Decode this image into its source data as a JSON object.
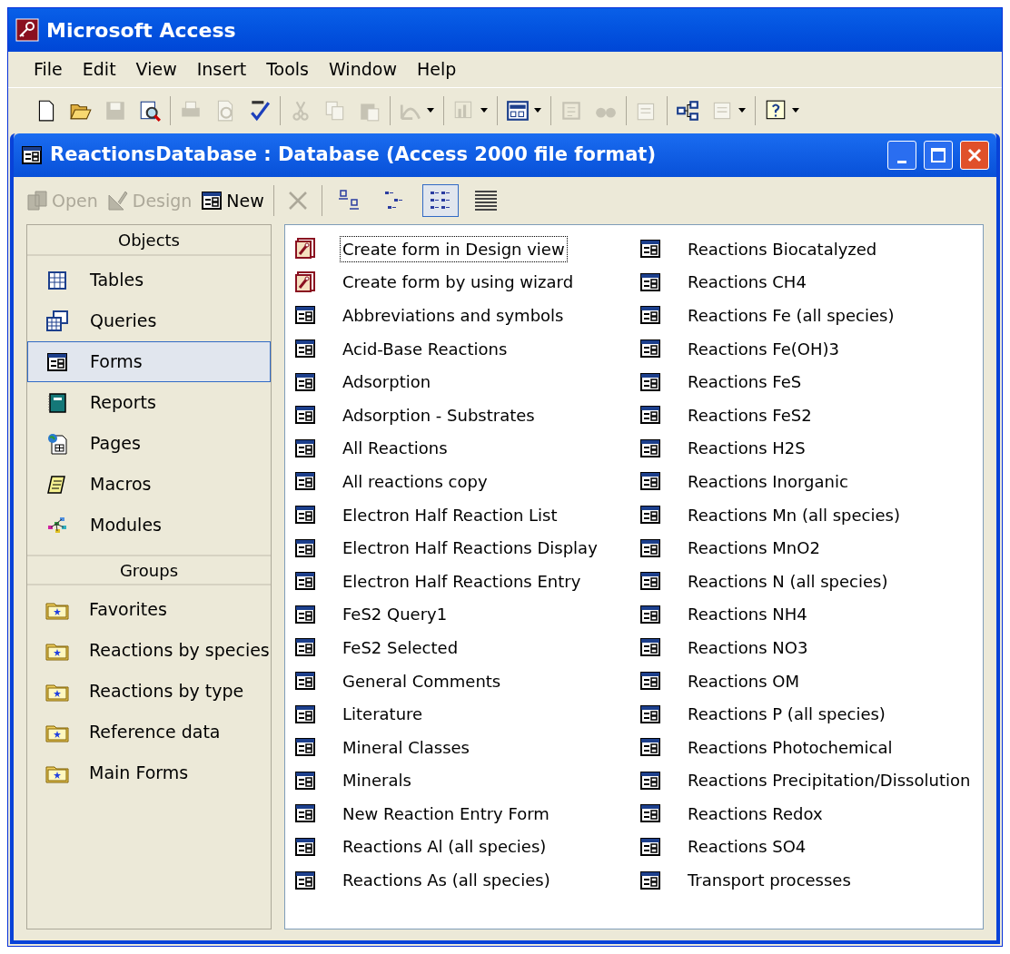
{
  "app_title": "Microsoft Access",
  "menu": [
    "File",
    "Edit",
    "View",
    "Insert",
    "Tools",
    "Window",
    "Help"
  ],
  "toolbar": [
    [
      {
        "disabled": false,
        "dropdown": false
      },
      {
        "disabled": false,
        "dropdown": false
      },
      {
        "disabled": true,
        "dropdown": false
      },
      {
        "disabled": false,
        "dropdown": false
      }
    ],
    [
      {
        "disabled": true,
        "dropdown": false
      },
      {
        "disabled": true,
        "dropdown": false
      },
      {
        "disabled": false,
        "dropdown": false
      }
    ],
    [
      {
        "disabled": true,
        "dropdown": false
      },
      {
        "disabled": true,
        "dropdown": false
      },
      {
        "disabled": true,
        "dropdown": false
      }
    ],
    [
      {
        "disabled": true,
        "dropdown": true
      }
    ],
    [
      {
        "disabled": true,
        "dropdown": true
      }
    ],
    [
      {
        "disabled": false,
        "dropdown": true
      }
    ],
    [
      {
        "disabled": true,
        "dropdown": false
      },
      {
        "disabled": true,
        "dropdown": false
      }
    ],
    [
      {
        "disabled": true,
        "dropdown": false
      }
    ],
    [
      {
        "disabled": false,
        "dropdown": false
      },
      {
        "disabled": true,
        "dropdown": true
      }
    ],
    [
      {
        "disabled": false,
        "dropdown": true
      }
    ]
  ],
  "db_window": {
    "title": "ReactionsDatabase : Database (Access 2000 file format)",
    "commands": [
      {
        "label": "Open",
        "disabled": true
      },
      {
        "label": "Design",
        "disabled": true
      },
      {
        "label": "New",
        "disabled": false
      }
    ],
    "delete_disabled": true,
    "views": [
      {
        "selected": false
      },
      {
        "selected": false
      },
      {
        "selected": true
      },
      {
        "selected": false
      }
    ],
    "objects_header": "Objects",
    "objects": [
      {
        "label": "Tables",
        "selected": false
      },
      {
        "label": "Queries",
        "selected": false
      },
      {
        "label": "Forms",
        "selected": true
      },
      {
        "label": "Reports",
        "selected": false
      },
      {
        "label": "Pages",
        "selected": false
      },
      {
        "label": "Macros",
        "selected": false
      },
      {
        "label": "Modules",
        "selected": false
      }
    ],
    "groups_header": "Groups",
    "groups": [
      "Favorites",
      "Reactions by species",
      "Reactions by type",
      "Reference data",
      "Main Forms"
    ],
    "items": [
      {
        "label": "Create form in Design view",
        "kind": "wizard",
        "focused": true
      },
      {
        "label": "Create form by using wizard",
        "kind": "wizard",
        "focused": false
      },
      {
        "label": "Abbreviations and symbols",
        "kind": "form",
        "focused": false
      },
      {
        "label": "Acid-Base Reactions",
        "kind": "form",
        "focused": false
      },
      {
        "label": "Adsorption",
        "kind": "form",
        "focused": false
      },
      {
        "label": "Adsorption - Substrates",
        "kind": "form",
        "focused": false
      },
      {
        "label": "All Reactions",
        "kind": "form",
        "focused": false
      },
      {
        "label": "All reactions copy",
        "kind": "form",
        "focused": false
      },
      {
        "label": "Electron Half Reaction List",
        "kind": "form",
        "focused": false
      },
      {
        "label": "Electron Half Reactions Display",
        "kind": "form",
        "focused": false
      },
      {
        "label": "Electron Half Reactions Entry",
        "kind": "form",
        "focused": false
      },
      {
        "label": "FeS2 Query1",
        "kind": "form",
        "focused": false
      },
      {
        "label": "FeS2 Selected",
        "kind": "form",
        "focused": false
      },
      {
        "label": "General Comments",
        "kind": "form",
        "focused": false
      },
      {
        "label": "Literature",
        "kind": "form",
        "focused": false
      },
      {
        "label": "Mineral Classes",
        "kind": "form",
        "focused": false
      },
      {
        "label": "Minerals",
        "kind": "form",
        "focused": false
      },
      {
        "label": "New Reaction Entry Form",
        "kind": "form",
        "focused": false
      },
      {
        "label": "Reactions Al (all species)",
        "kind": "form",
        "focused": false
      },
      {
        "label": "Reactions As (all species)",
        "kind": "form",
        "focused": false
      },
      {
        "label": "Reactions Biocatalyzed",
        "kind": "form",
        "focused": false
      },
      {
        "label": "Reactions CH4",
        "kind": "form",
        "focused": false
      },
      {
        "label": "Reactions Fe (all species)",
        "kind": "form",
        "focused": false
      },
      {
        "label": "Reactions Fe(OH)3",
        "kind": "form",
        "focused": false
      },
      {
        "label": "Reactions FeS",
        "kind": "form",
        "focused": false
      },
      {
        "label": "Reactions FeS2",
        "kind": "form",
        "focused": false
      },
      {
        "label": "Reactions H2S",
        "kind": "form",
        "focused": false
      },
      {
        "label": "Reactions Inorganic",
        "kind": "form",
        "focused": false
      },
      {
        "label": "Reactions Mn (all species)",
        "kind": "form",
        "focused": false
      },
      {
        "label": "Reactions MnO2",
        "kind": "form",
        "focused": false
      },
      {
        "label": "Reactions N (all species)",
        "kind": "form",
        "focused": false
      },
      {
        "label": "Reactions NH4",
        "kind": "form",
        "focused": false
      },
      {
        "label": "Reactions NO3",
        "kind": "form",
        "focused": false
      },
      {
        "label": "Reactions OM",
        "kind": "form",
        "focused": false
      },
      {
        "label": "Reactions P (all species)",
        "kind": "form",
        "focused": false
      },
      {
        "label": "Reactions Photochemical",
        "kind": "form",
        "focused": false
      },
      {
        "label": "Reactions Precipitation/Dissolution",
        "kind": "form",
        "focused": false
      },
      {
        "label": "Reactions Redox",
        "kind": "form",
        "focused": false
      },
      {
        "label": "Reactions SO4",
        "kind": "form",
        "focused": false
      },
      {
        "label": "Transport processes",
        "kind": "form",
        "focused": false
      }
    ]
  }
}
